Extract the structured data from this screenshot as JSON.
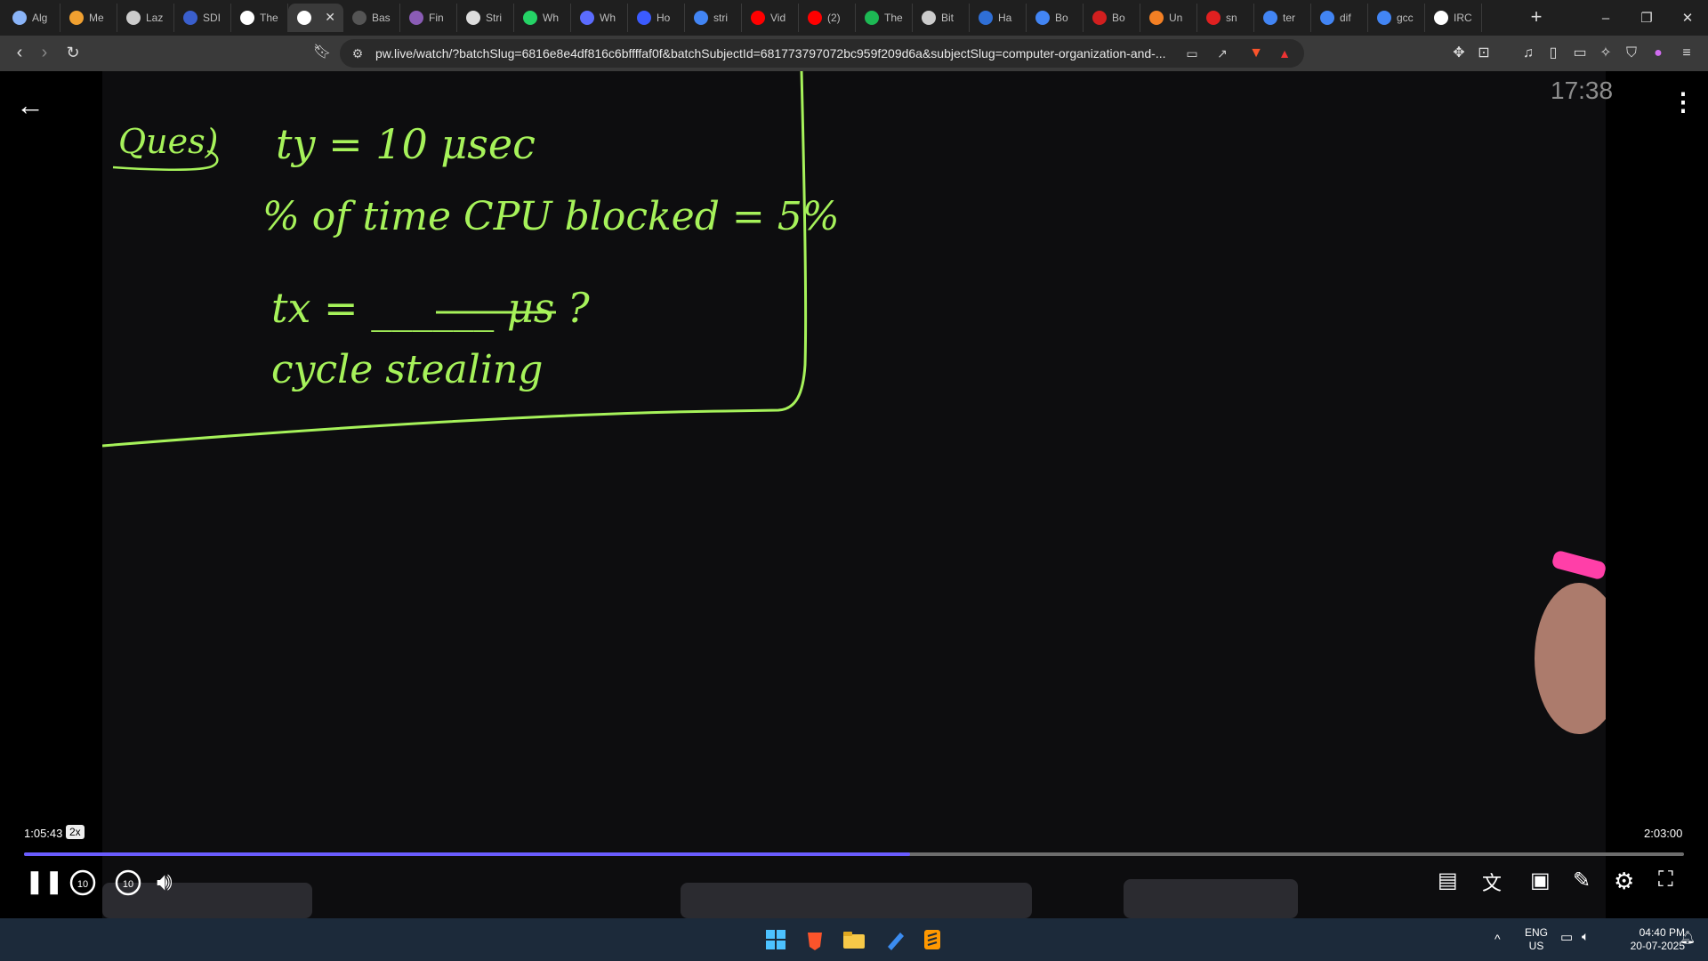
{
  "browser": {
    "tabs": [
      {
        "label": "Alg",
        "color": "#8ab4f8"
      },
      {
        "label": "Me",
        "color": "#f0a030"
      },
      {
        "label": "Laz",
        "color": "#cccccc"
      },
      {
        "label": "SDI",
        "color": "#3a5fcd"
      },
      {
        "label": "The",
        "color": "#ffffff"
      },
      {
        "label": "",
        "color": "#ffffff"
      },
      {
        "label": "Bas",
        "color": "#555555"
      },
      {
        "label": "Fin",
        "color": "#8a5cb5"
      },
      {
        "label": "Stri",
        "color": "#dddddd"
      },
      {
        "label": "Wh",
        "color": "#25d366"
      },
      {
        "label": "Wh",
        "color": "#5b6cff"
      },
      {
        "label": "Ho",
        "color": "#3b5bff"
      },
      {
        "label": "stri",
        "color": "#4285f4"
      },
      {
        "label": "Vid",
        "color": "#ff0000"
      },
      {
        "label": "(2)",
        "color": "#ff0000"
      },
      {
        "label": "The",
        "color": "#1db954"
      },
      {
        "label": "Bit",
        "color": "#cccccc"
      },
      {
        "label": "Ha",
        "color": "#2f6fd6"
      },
      {
        "label": "Bo",
        "color": "#4285f4"
      },
      {
        "label": "Bo",
        "color": "#d21f1f"
      },
      {
        "label": "Un",
        "color": "#f48024"
      },
      {
        "label": "sn",
        "color": "#e02020"
      },
      {
        "label": "ter",
        "color": "#4285f4"
      },
      {
        "label": "dif",
        "color": "#4285f4"
      },
      {
        "label": "gcc",
        "color": "#4285f4"
      },
      {
        "label": "IRC",
        "color": "#ffffff"
      }
    ],
    "active_tab_index": 5,
    "new_tab": "+",
    "url": "pw.live/watch/?batchSlug=6816e8e4df816c6bffffaf0f&batchSubjectId=681773797072bc959f209d6a&subjectSlug=computer-organization-and-...",
    "window_controls": [
      "–",
      "❐",
      "✕"
    ]
  },
  "board": {
    "lines": [
      "Ques)",
      "ty = 10 μsec",
      "% of time CPU blocked = 5%",
      "tx = ______ μs ?",
      "cycle stealing"
    ],
    "clock": "17:38"
  },
  "player": {
    "current_time": "1:05:43",
    "speed": "2x",
    "duration": "2:03:00",
    "progress": 0.534,
    "skip_back": "10",
    "skip_forward": "10"
  },
  "taskbar": {
    "language": "ENG",
    "region": "US",
    "time": "04:40 PM",
    "date": "20-07-2025"
  },
  "colors": {
    "chalk": "#a6f25a",
    "progress": "#6a5cff",
    "taskbar": "#1c2a3a"
  }
}
